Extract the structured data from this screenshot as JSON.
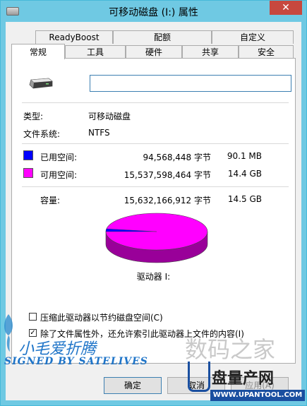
{
  "window": {
    "title": "可移动磁盘 (I:) 属性",
    "close_label": "✕"
  },
  "tabs_back": [
    "ReadyBoost",
    "配额",
    "自定义"
  ],
  "tabs_front": [
    "常规",
    "工具",
    "硬件",
    "共享",
    "安全"
  ],
  "general": {
    "name_value": "",
    "type_label": "类型:",
    "type_value": "可移动磁盘",
    "fs_label": "文件系统:",
    "fs_value": "NTFS",
    "used_label": "已用空间:",
    "used_bytes": "94,568,448 字节",
    "used_size": "90.1 MB",
    "free_label": "可用空间:",
    "free_bytes": "15,537,598,464 字节",
    "free_size": "14.4 GB",
    "cap_label": "容量:",
    "cap_bytes": "15,632,166,912 字节",
    "cap_size": "14.5 GB",
    "drive_label": "驱动器 I:",
    "used_fraction": 0.00605,
    "colors": {
      "used": "#0000ff",
      "free": "#ff00ff"
    }
  },
  "options": {
    "compress_label": "压缩此驱动器以节约磁盘空间(C)",
    "compress_checked": false,
    "index_label": "除了文件属性外，还允许索引此驱动器上文件的内容(I)",
    "index_checked": true
  },
  "buttons": {
    "ok": "确定",
    "cancel": "取消",
    "apply": "应用(A)"
  },
  "watermarks": {
    "left_cn": "小毛爱折腾",
    "left_en": "SIGNED BY SATELIVES",
    "right_cn": "数码之家",
    "right_brand": "盘量产网",
    "right_url": "WWW.UPANTOOL.COM"
  }
}
